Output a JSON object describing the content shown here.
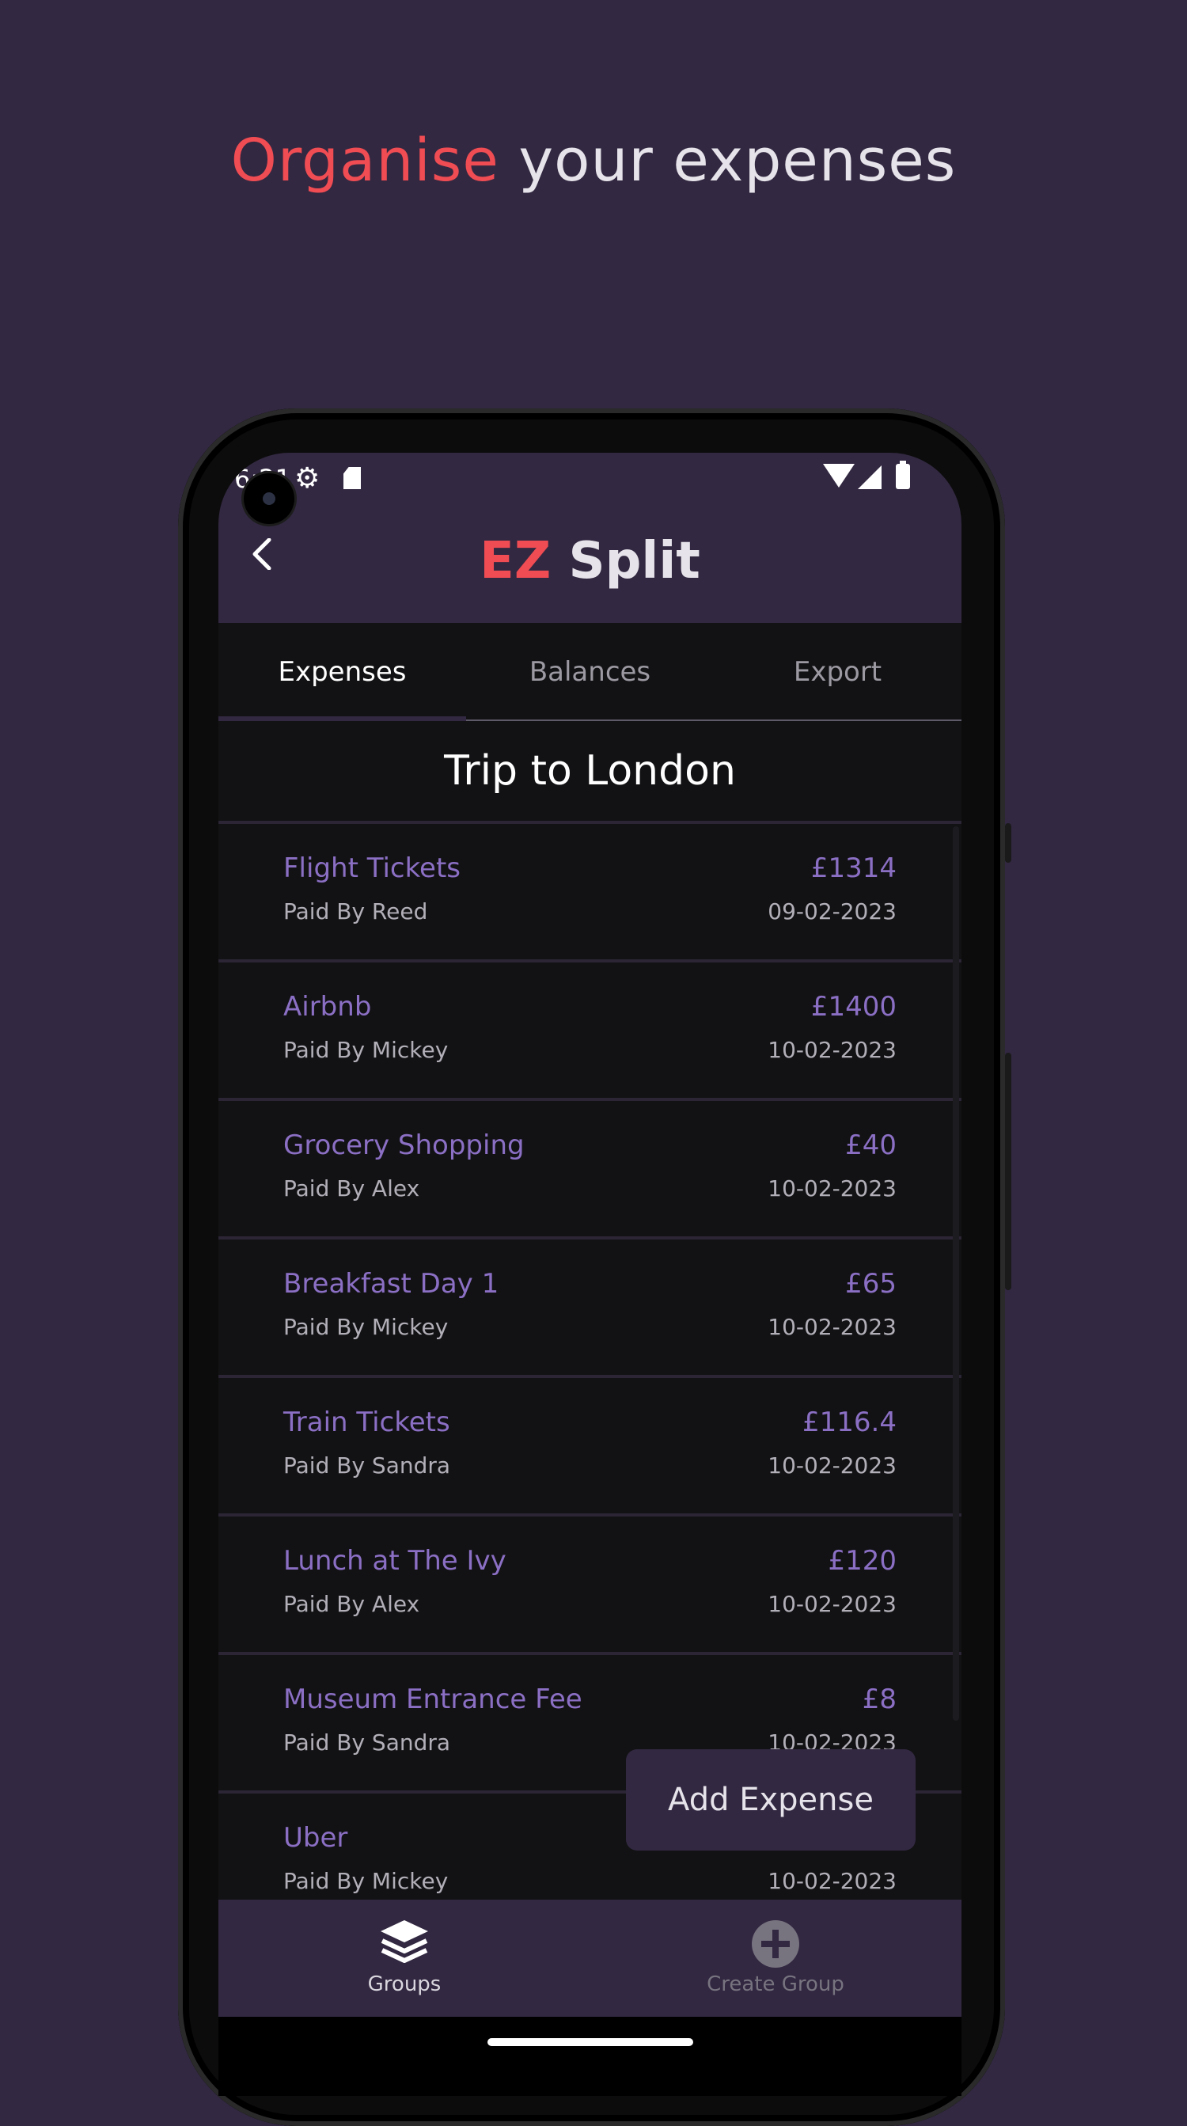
{
  "headline": {
    "accent": "Organise",
    "rest": " your expenses"
  },
  "status_bar": {
    "time": "6:21"
  },
  "app_bar": {
    "title_accent": "EZ",
    "title_rest": " Split"
  },
  "tabs": [
    {
      "label": "Expenses",
      "active": true
    },
    {
      "label": "Balances",
      "active": false
    },
    {
      "label": "Export",
      "active": false
    }
  ],
  "group_title": "Trip to London",
  "expenses": [
    {
      "name": "Flight Tickets",
      "payer": "Paid By Reed",
      "amount": "£1314",
      "date": "09-02-2023"
    },
    {
      "name": "Airbnb",
      "payer": "Paid By Mickey",
      "amount": "£1400",
      "date": "10-02-2023"
    },
    {
      "name": "Grocery Shopping",
      "payer": "Paid By Alex",
      "amount": "£40",
      "date": "10-02-2023"
    },
    {
      "name": "Breakfast Day 1",
      "payer": "Paid By Mickey",
      "amount": "£65",
      "date": "10-02-2023"
    },
    {
      "name": "Train Tickets",
      "payer": "Paid By Sandra",
      "amount": "£116.4",
      "date": "10-02-2023"
    },
    {
      "name": "Lunch at The Ivy",
      "payer": "Paid By Alex",
      "amount": "£120",
      "date": "10-02-2023"
    },
    {
      "name": "Museum Entrance Fee",
      "payer": "Paid By Sandra",
      "amount": "£8",
      "date": "10-02-2023"
    },
    {
      "name": "Uber",
      "payer": "Paid By Mickey",
      "amount": "",
      "date": "10-02-2023"
    }
  ],
  "fab_label": "Add Expense",
  "bottom_nav": [
    {
      "label": "Groups",
      "icon": "layers-icon",
      "active": true
    },
    {
      "label": "Create Group",
      "icon": "plus-circle-icon",
      "active": false
    }
  ],
  "colors": {
    "background": "#322841",
    "accent": "#ef4c53",
    "item_text": "#8b6fc4",
    "list_bg": "#121214"
  }
}
